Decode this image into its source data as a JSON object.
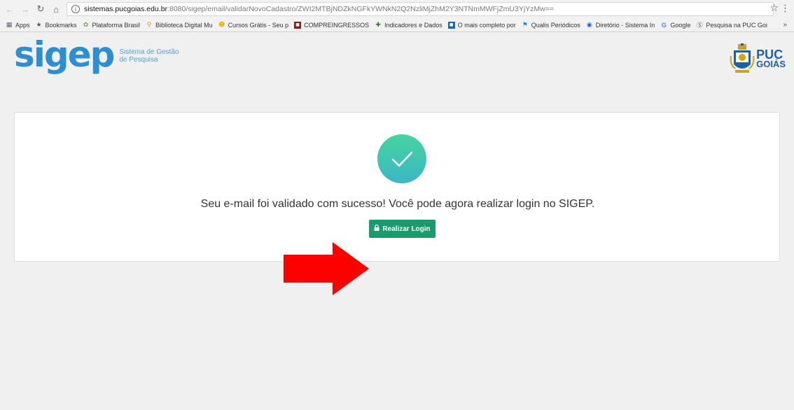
{
  "browser": {
    "url_host": "sistemas.pucgoias.edu.br",
    "url_path": ":8080/sigep/email/validarNovoCadastro/ZWI2MTBjNDZkNGFkYWNkN2Q2NzliMjZhM2Y3NTNmMWFjZmU3YjYzMw==",
    "bookmarks": [
      {
        "label": "Apps",
        "icon": "apps-icon",
        "color": "#5f6368"
      },
      {
        "label": "Bookmarks",
        "icon": "star-icon",
        "color": "#555555"
      },
      {
        "label": "Plataforma Brasil",
        "icon": "leaf-icon",
        "color": "#6aa84f"
      },
      {
        "label": "Biblioteca Digital Mu",
        "icon": "pin-icon",
        "color": "#d4a017"
      },
      {
        "label": "Cursos Grátis - Seu p",
        "icon": "smile-icon",
        "color": "#e6b800"
      },
      {
        "label": "COMPREINGRESSOS",
        "icon": "ticket-icon",
        "color": "#8b1a1a"
      },
      {
        "label": "Indicadores e Dados",
        "icon": "cross-icon",
        "color": "#2e7d32"
      },
      {
        "label": "O mais completo por",
        "icon": "dm-icon",
        "color": "#1565c0"
      },
      {
        "label": "Qualis Periódicos",
        "icon": "flag-icon",
        "color": "#1e88e5"
      },
      {
        "label": "Diretório - Sistema In",
        "icon": "directory-icon",
        "color": "#1565c0"
      },
      {
        "label": "Google",
        "icon": "google-icon",
        "color": "#4285f4"
      },
      {
        "label": "Pesquisa na PUC Goi",
        "icon": "wordpress-icon",
        "color": "#555555"
      }
    ]
  },
  "header": {
    "logo_text": "sigep",
    "logo_subtitle_1": "Sistema de Gestão",
    "logo_subtitle_2": "de Pesquisa",
    "puc_line1": "PUC",
    "puc_line2": "GOIÁS"
  },
  "main": {
    "message": "Seu e-mail foi validado com sucesso! Você pode agora realizar login no SIGEP.",
    "login_button": "Realizar Login"
  },
  "colors": {
    "brand_blue": "#2e8fd0",
    "button_green": "#1a9b6c",
    "arrow_red": "#ff0000",
    "check_gradient_top": "#46d3a0",
    "check_gradient_bottom": "#3bb7c4"
  }
}
